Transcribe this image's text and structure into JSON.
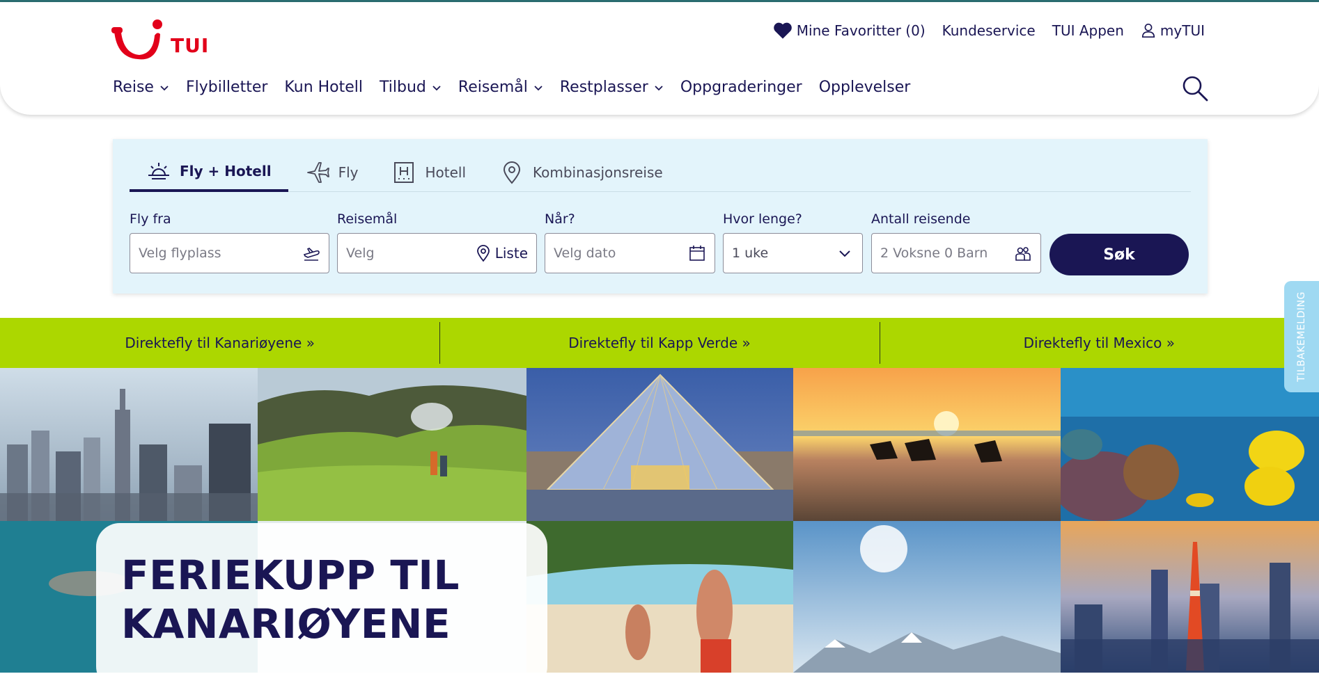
{
  "brand": {
    "name": "TUI",
    "color": "#e2001a"
  },
  "utility_nav": {
    "favorites": "Mine Favoritter (0)",
    "customer_service": "Kundeservice",
    "app": "TUI Appen",
    "account": "myTUI"
  },
  "main_nav": {
    "items": [
      {
        "label": "Reise",
        "dropdown": true
      },
      {
        "label": "Flybilletter",
        "dropdown": false
      },
      {
        "label": "Kun Hotell",
        "dropdown": false
      },
      {
        "label": "Tilbud",
        "dropdown": true
      },
      {
        "label": "Reisemål",
        "dropdown": true
      },
      {
        "label": "Restplasser",
        "dropdown": true
      },
      {
        "label": "Oppgraderinger",
        "dropdown": false
      },
      {
        "label": "Opplevelser",
        "dropdown": false
      }
    ]
  },
  "search": {
    "tabs": [
      {
        "label": "Fly + Hotell",
        "icon": "sun-icon",
        "active": true
      },
      {
        "label": "Fly",
        "icon": "plane-icon",
        "active": false
      },
      {
        "label": "Hotell",
        "icon": "hotel-icon",
        "active": false
      },
      {
        "label": "Kombinasjonsreise",
        "icon": "location-pin-icon",
        "active": false
      }
    ],
    "fields": {
      "from": {
        "label": "Fly fra",
        "placeholder": "Velg flyplass"
      },
      "destination": {
        "label": "Reisemål",
        "placeholder": "Velg",
        "list_label": "Liste"
      },
      "when": {
        "label": "Når?",
        "placeholder": "Velg dato"
      },
      "duration": {
        "label": "Hvor lenge?",
        "value": "1 uke"
      },
      "travellers": {
        "label": "Antall reisende",
        "value": "2 Voksne 0 Barn"
      }
    },
    "submit_label": "Søk"
  },
  "quick_links": [
    "Direktefly til Kanariøyene »",
    "Direktefly til Kapp Verde »",
    "Direktefly til Mexico »"
  ],
  "promo": {
    "title_line1": "FERIEKUPP TIL",
    "title_line2": "KANARIØYENE"
  },
  "feedback": {
    "label": "TILBAKEMELDING"
  },
  "colors": {
    "navy": "#1a1654",
    "panel_bg": "#e3f4fb",
    "green_bar": "#acd700",
    "feedback_tab": "#9fd9f2"
  }
}
